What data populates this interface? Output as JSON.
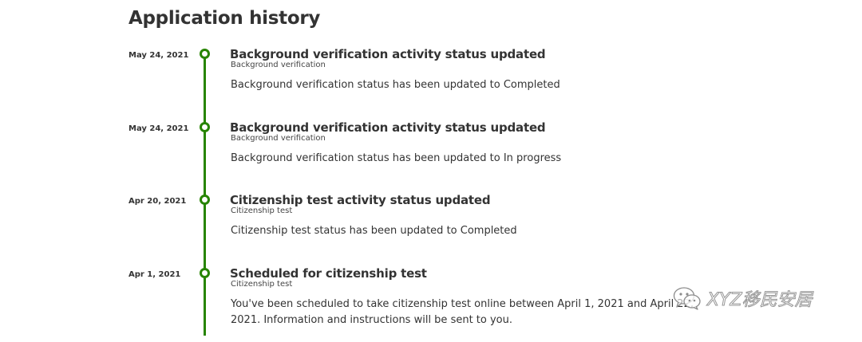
{
  "page": {
    "title": "Application history"
  },
  "colors": {
    "accent": "#278400",
    "text": "#333333"
  },
  "entries": [
    {
      "date": "May 24, 2021",
      "title": "Background verification activity status updated",
      "category": "Background verification",
      "description": "Background verification status has been updated to Completed"
    },
    {
      "date": "May 24, 2021",
      "title": "Background verification activity status updated",
      "category": "Background verification",
      "description": "Background verification status has been updated to In progress"
    },
    {
      "date": "Apr 20, 2021",
      "title": "Citizenship test activity status updated",
      "category": "Citizenship test",
      "description": "Citizenship test status has been updated to Completed"
    },
    {
      "date": "Apr 1, 2021",
      "title": "Scheduled for citizenship test",
      "category": "Citizenship test",
      "description": "You've been scheduled to take citizenship test online between April 1, 2021 and April 22, 2021. Information and instructions will be sent to you."
    }
  ],
  "watermark": {
    "icon": "wechat-icon",
    "text": "XYZ移民安居"
  }
}
